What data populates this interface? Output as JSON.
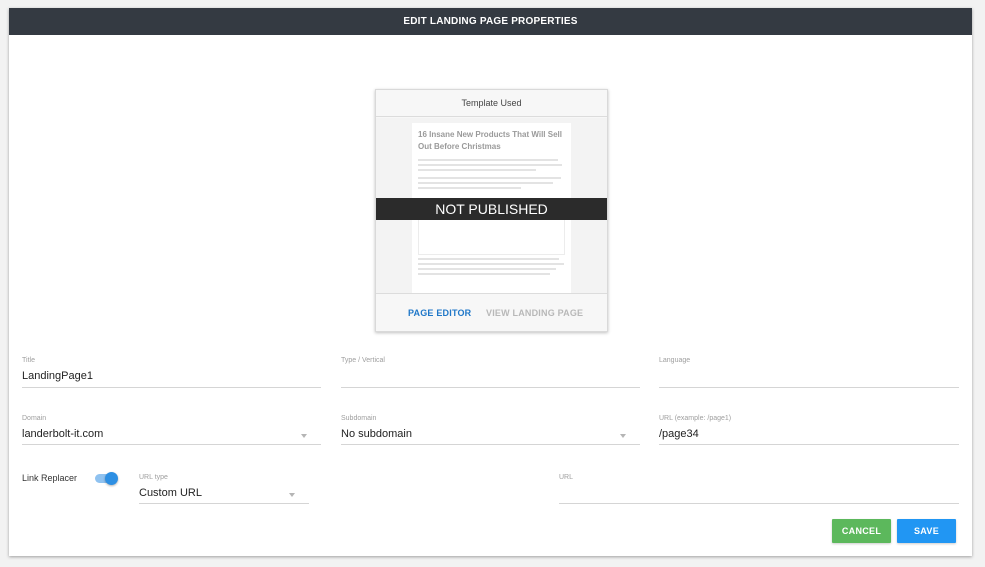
{
  "dialog": {
    "title": "EDIT LANDING PAGE PROPERTIES"
  },
  "template_card": {
    "header": "Template Used",
    "preview_title": "16 Insane New Products That Will Sell Out Before Christmas",
    "status_banner": "NOT PUBLISHED",
    "page_editor_label": "PAGE EDITOR",
    "view_landing_page_label": "VIEW LANDING PAGE"
  },
  "form": {
    "title": {
      "label": "Title",
      "value": "LandingPage1"
    },
    "type_vertical": {
      "label": "Type / Vertical",
      "value": ""
    },
    "language": {
      "label": "Language",
      "value": ""
    },
    "domain": {
      "label": "Domain",
      "value": "landerbolt-it.com"
    },
    "subdomain": {
      "label": "Subdomain",
      "value": "No subdomain"
    },
    "url_path": {
      "label": "URL (example: /page1)",
      "value": "/page34"
    },
    "link_replacer": {
      "label": "Link Replacer",
      "enabled": true
    },
    "url_type": {
      "label": "URL type",
      "value": "Custom URL"
    },
    "url": {
      "label": "URL",
      "value": ""
    }
  },
  "buttons": {
    "cancel": "CANCEL",
    "save": "SAVE"
  },
  "colors": {
    "header_bg": "#343a42",
    "cancel": "#5cb85c",
    "save": "#2196f3",
    "link": "#1f77c8",
    "toggle": "#2d8fe3"
  }
}
